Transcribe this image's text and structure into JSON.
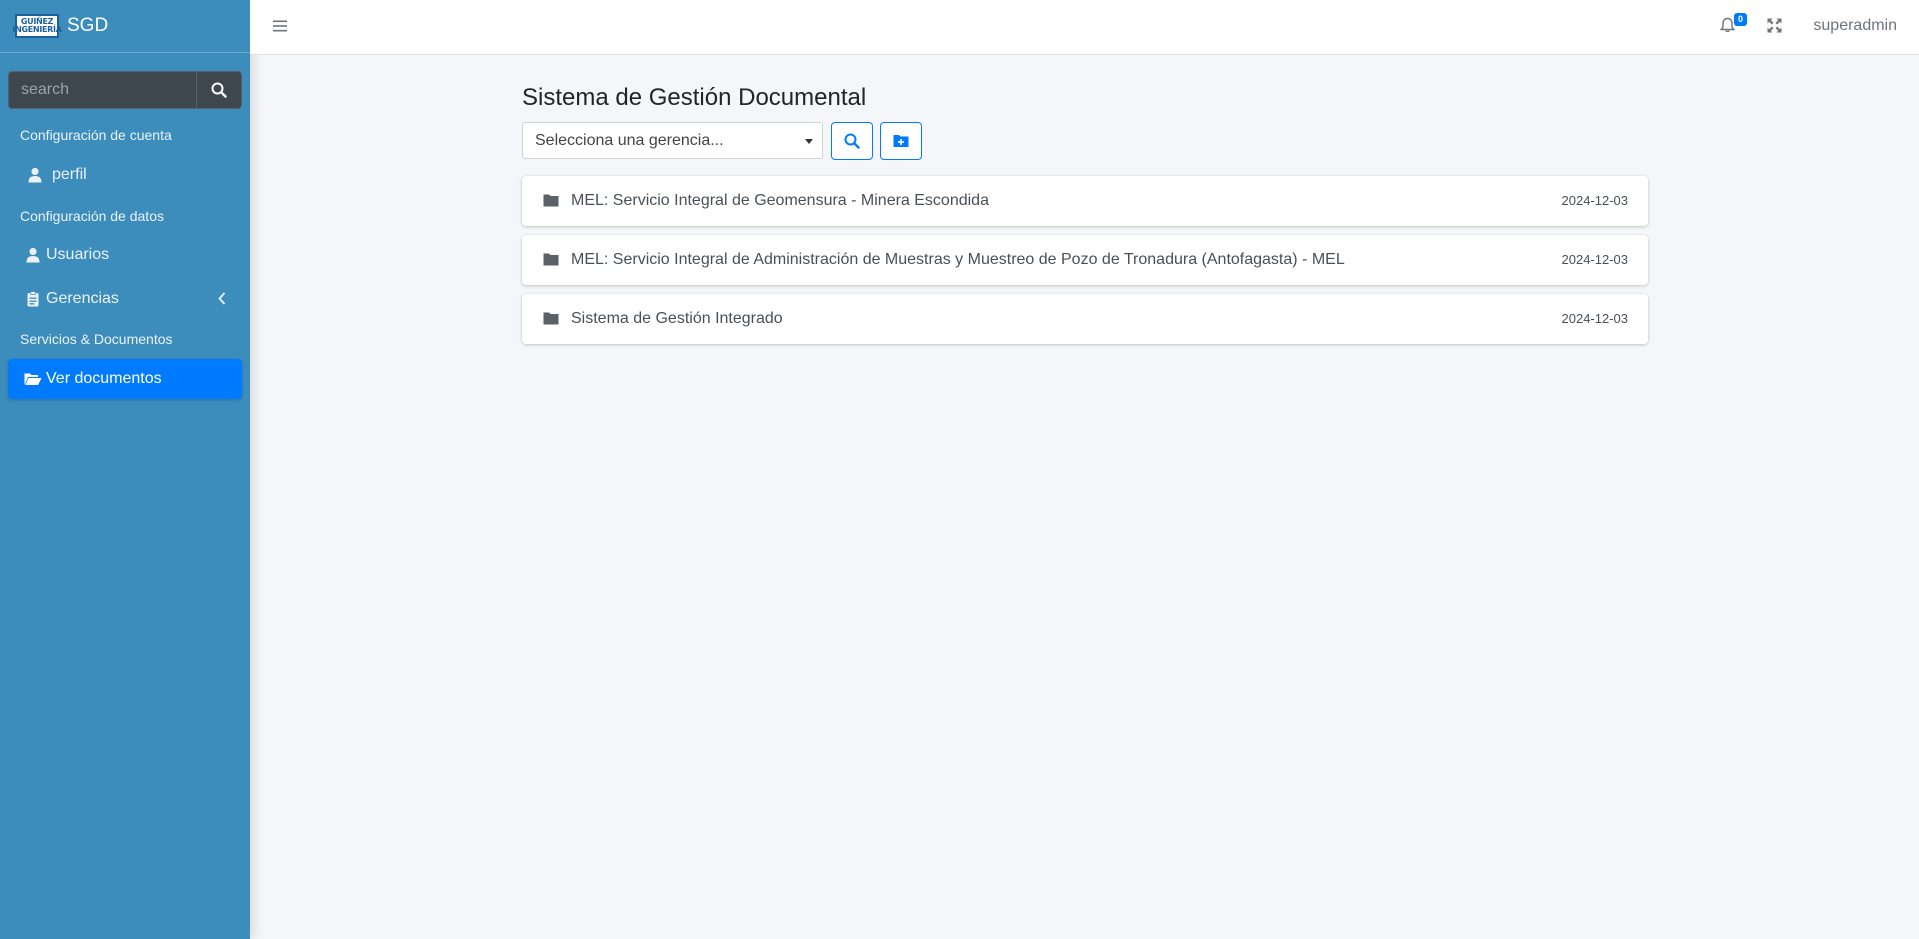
{
  "brand": {
    "logo_text": "GUIÑEZ INGENIERÍA",
    "name": "SGD"
  },
  "sidebar": {
    "search_placeholder": "search",
    "sections": [
      {
        "header": "Configuración de cuenta",
        "items": [
          {
            "label": "perfil",
            "icon": "user-icon"
          }
        ]
      },
      {
        "header": "Configuración de datos",
        "items": [
          {
            "label": "Usuarios",
            "icon": "user-icon"
          },
          {
            "label": "Gerencias",
            "icon": "clipboard-icon",
            "has_submenu": true
          }
        ]
      },
      {
        "header": "Servicios & Documentos",
        "items": [
          {
            "label": "Ver documentos",
            "icon": "folder-open-icon",
            "active": true
          }
        ]
      }
    ]
  },
  "topbar": {
    "notification_count": "0",
    "username": "superadmin"
  },
  "main": {
    "title": "Sistema de Gestión Documental",
    "select_placeholder": "Selecciona una gerencia...",
    "documents": [
      {
        "title": "MEL: Servicio Integral de Geomensura - Minera Escondida",
        "date": "2024-12-03"
      },
      {
        "title": "MEL: Servicio Integral de Administración de Muestras y Muestreo de Pozo de Tronadura (Antofagasta) - MEL",
        "date": "2024-12-03"
      },
      {
        "title": "Sistema de Gestión Integrado",
        "date": "2024-12-03"
      }
    ]
  },
  "colors": {
    "sidebar_bg": "#3c8dbc",
    "accent": "#007bff",
    "content_bg": "#f4f6f9"
  }
}
